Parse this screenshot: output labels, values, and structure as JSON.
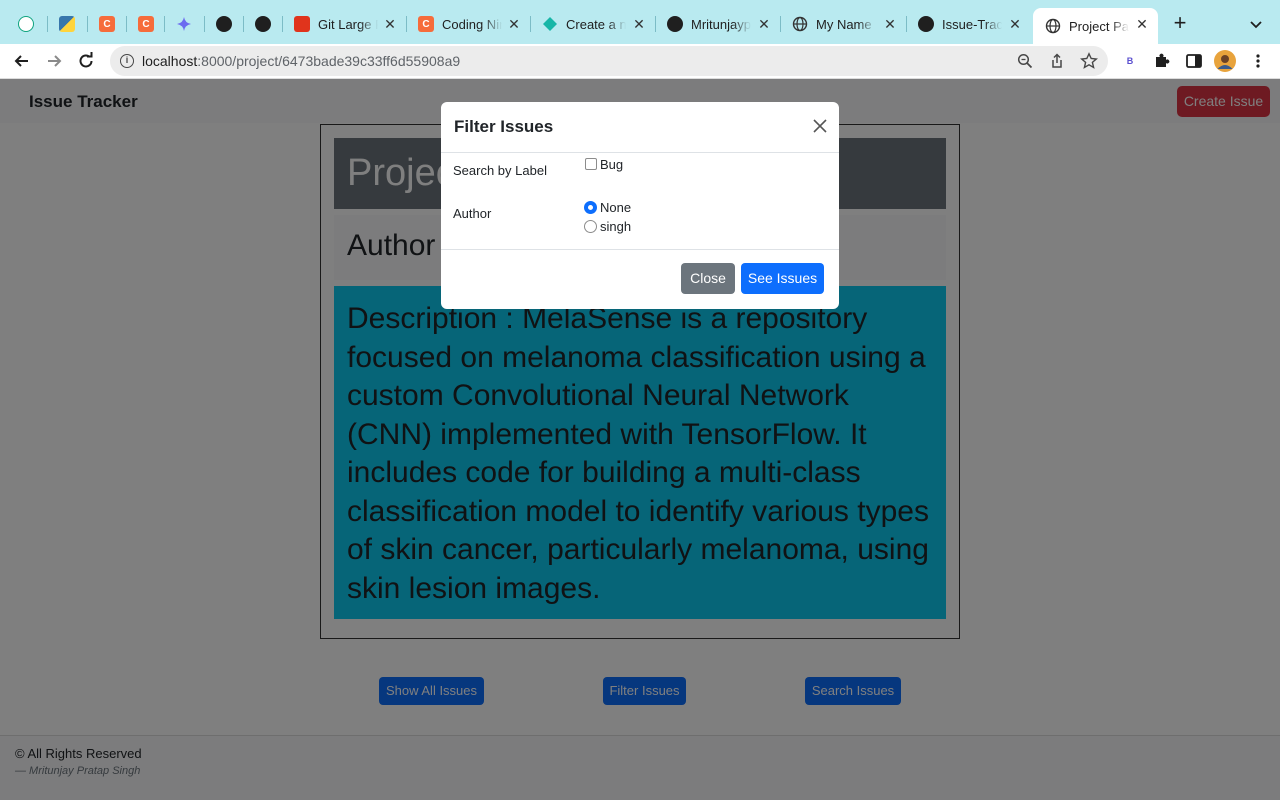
{
  "browser": {
    "tabs": [
      {
        "title": "",
        "icon": "chatgpt-icon"
      },
      {
        "title": "",
        "icon": "python-icon"
      },
      {
        "title": "",
        "icon": "coding-ninjas-icon"
      },
      {
        "title": "",
        "icon": "coding-ninjas-icon"
      },
      {
        "title": "",
        "icon": "gemini-icon"
      },
      {
        "title": "",
        "icon": "github-icon"
      },
      {
        "title": "",
        "icon": "github-icon"
      },
      {
        "title": "Git Large F",
        "icon": "git-lfs-icon"
      },
      {
        "title": "Coding Nin",
        "icon": "coding-ninjas-icon"
      },
      {
        "title": "Create a n",
        "icon": "diamond-icon"
      },
      {
        "title": "Mritunjayp",
        "icon": "github-icon"
      },
      {
        "title": "My Name",
        "icon": "globe-icon"
      },
      {
        "title": "Issue-Trac",
        "icon": "github-icon"
      },
      {
        "title": "Project Pa",
        "icon": "globe-icon"
      }
    ],
    "url_host": "localhost",
    "url_path": ":8000/project/6473bade39c33ff6d55908a9",
    "extension_badge": "B"
  },
  "navbar": {
    "brand": "Issue Tracker",
    "create_button": "Create Issue"
  },
  "project": {
    "heading": "Project",
    "author_label": "Author",
    "description": "Description : MelaSense is a repository focused on melanoma classification using a custom Convolutional Neural Network (CNN) implemented with TensorFlow. It includes code for building a multi-class classification model to identify various types of skin cancer, particularly melanoma, using skin lesion images."
  },
  "actions": {
    "show_all": "Show All Issues",
    "filter": "Filter Issues",
    "search": "Search Issues"
  },
  "footer": {
    "rights": "© All Rights Reserved",
    "author": "— Mritunjay Pratap Singh"
  },
  "modal": {
    "title": "Filter Issues",
    "label_field": "Search by Label",
    "label_options": [
      {
        "label": "Bug",
        "checked": false
      }
    ],
    "author_field": "Author",
    "author_options": [
      {
        "label": "None",
        "selected": true
      },
      {
        "label": "singh",
        "selected": false
      }
    ],
    "close_button": "Close",
    "submit_button": "See Issues"
  },
  "colors": {
    "tabstrip": "#b9eaf0",
    "danger": "#dc3545",
    "primary": "#0d6efd",
    "secondary": "#6c757d",
    "info": "#0dcaf0"
  }
}
